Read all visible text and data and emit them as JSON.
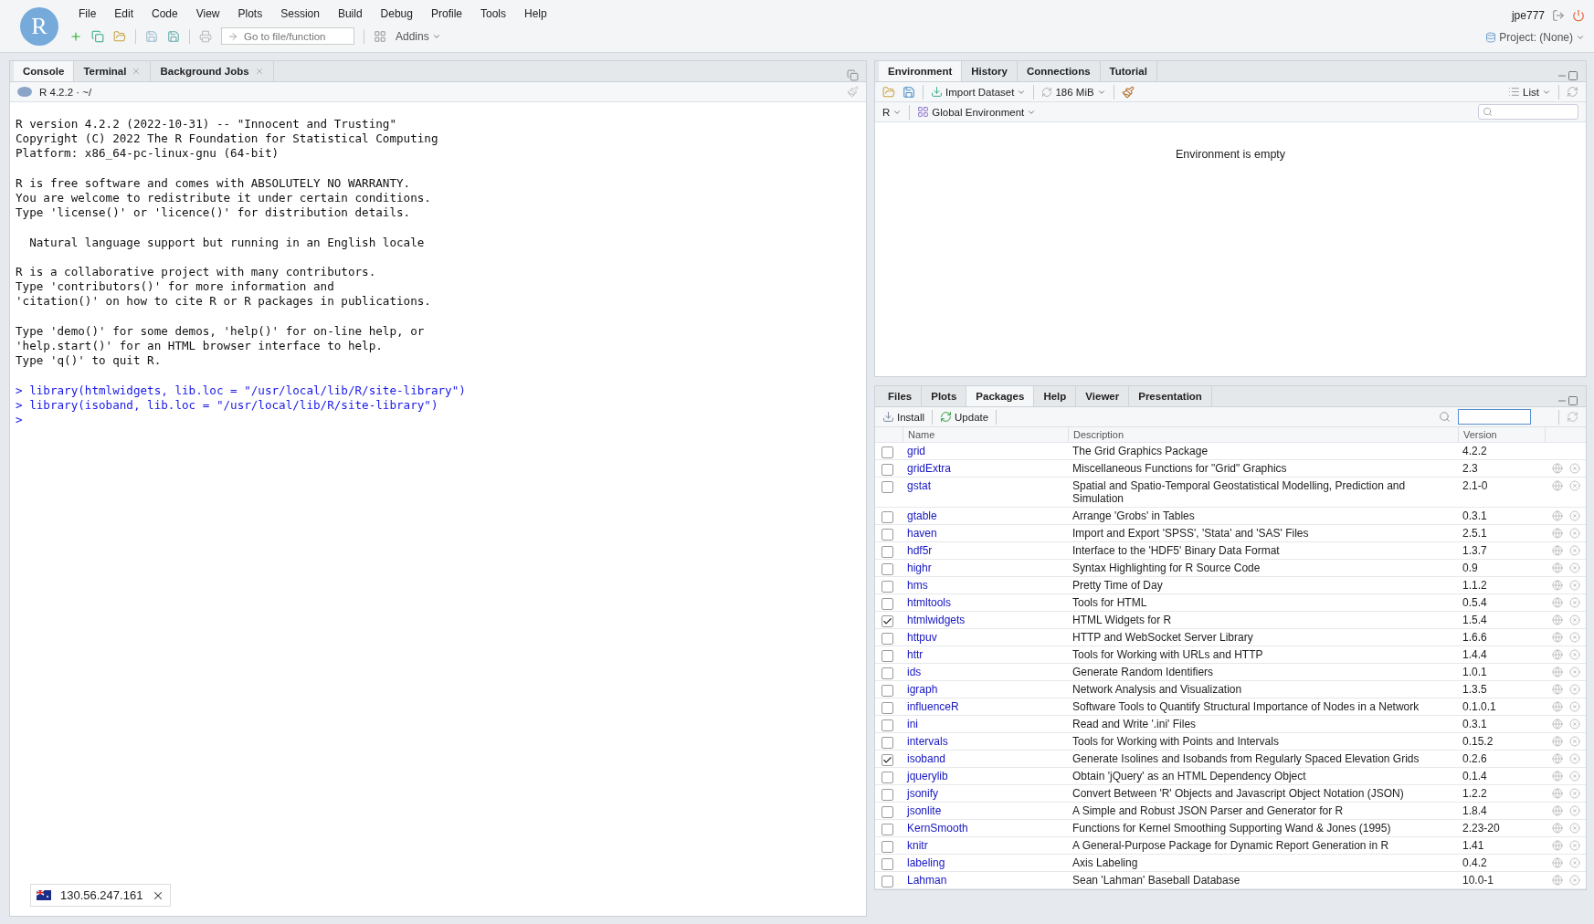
{
  "menu_bar": {
    "logo": "R",
    "items": [
      "File",
      "Edit",
      "Code",
      "View",
      "Plots",
      "Session",
      "Build",
      "Debug",
      "Profile",
      "Tools",
      "Help"
    ],
    "user": "jpe777"
  },
  "toolbar": {
    "goto_placeholder": "Go to file/function",
    "addins": "Addins",
    "project": "Project: (None)"
  },
  "console_pane": {
    "tabs": [
      {
        "label": "Console",
        "selected": true,
        "closable": false
      },
      {
        "label": "Terminal",
        "selected": false,
        "closable": true
      },
      {
        "label": "Background Jobs",
        "selected": false,
        "closable": true
      }
    ],
    "version": "R 4.2.2 · ~/",
    "output": [
      {
        "kind": "text",
        "lines": [
          "R version 4.2.2 (2022-10-31) -- \"Innocent and Trusting\"",
          "Copyright (C) 2022 The R Foundation for Statistical Computing",
          "Platform: x86_64-pc-linux-gnu (64-bit)"
        ]
      },
      {
        "kind": "text",
        "lines": [
          "R is free software and comes with ABSOLUTELY NO WARRANTY.",
          "You are welcome to redistribute it under certain conditions.",
          "Type 'license()' or 'licence()' for distribution details."
        ]
      },
      {
        "kind": "text",
        "lines": [
          "  Natural language support but running in an English locale"
        ]
      },
      {
        "kind": "text",
        "lines": [
          "R is a collaborative project with many contributors.",
          "Type 'contributors()' for more information and",
          "'citation()' on how to cite R or R packages in publications."
        ]
      },
      {
        "kind": "text",
        "lines": [
          "Type 'demo()' for some demos, 'help()' for on-line help, or",
          "'help.start()' for an HTML browser interface to help.",
          "Type 'q()' to quit R."
        ]
      },
      {
        "kind": "command",
        "lines": [
          "> library(htmlwidgets, lib.loc = \"/usr/local/lib/R/site-library\")",
          "> library(isoband, lib.loc = \"/usr/local/lib/R/site-library\")",
          ">"
        ]
      }
    ]
  },
  "environment_pane": {
    "tabs": [
      {
        "label": "Environment",
        "selected": true
      },
      {
        "label": "History",
        "selected": false
      },
      {
        "label": "Connections",
        "selected": false
      },
      {
        "label": "Tutorial",
        "selected": false
      }
    ],
    "import_dataset": "Import Dataset",
    "memory": "186 MiB",
    "view": "List",
    "language": "R",
    "scope": "Global Environment",
    "empty_message": "Environment is empty"
  },
  "packages_pane": {
    "tabs": [
      {
        "label": "Files",
        "selected": false
      },
      {
        "label": "Plots",
        "selected": false
      },
      {
        "label": "Packages",
        "selected": true
      },
      {
        "label": "Help",
        "selected": false
      },
      {
        "label": "Viewer",
        "selected": false
      },
      {
        "label": "Presentation",
        "selected": false
      }
    ],
    "install": "Install",
    "update": "Update",
    "columns": [
      "Name",
      "Description",
      "Version"
    ],
    "rows": [
      {
        "name": "grid",
        "description": "The Grid Graphics Package",
        "version": "4.2.2",
        "checked": false,
        "removable": false
      },
      {
        "name": "gridExtra",
        "description": "Miscellaneous Functions for \"Grid\" Graphics",
        "version": "2.3",
        "checked": false,
        "removable": true
      },
      {
        "name": "gstat",
        "description": "Spatial and Spatio-Temporal Geostatistical Modelling, Prediction and Simulation",
        "version": "2.1-0",
        "checked": false,
        "removable": true
      },
      {
        "name": "gtable",
        "description": "Arrange 'Grobs' in Tables",
        "version": "0.3.1",
        "checked": false,
        "removable": true
      },
      {
        "name": "haven",
        "description": "Import and Export 'SPSS', 'Stata' and 'SAS' Files",
        "version": "2.5.1",
        "checked": false,
        "removable": true
      },
      {
        "name": "hdf5r",
        "description": "Interface to the 'HDF5' Binary Data Format",
        "version": "1.3.7",
        "checked": false,
        "removable": true
      },
      {
        "name": "highr",
        "description": "Syntax Highlighting for R Source Code",
        "version": "0.9",
        "checked": false,
        "removable": true
      },
      {
        "name": "hms",
        "description": "Pretty Time of Day",
        "version": "1.1.2",
        "checked": false,
        "removable": true
      },
      {
        "name": "htmltools",
        "description": "Tools for HTML",
        "version": "0.5.4",
        "checked": false,
        "removable": true
      },
      {
        "name": "htmlwidgets",
        "description": "HTML Widgets for R",
        "version": "1.5.4",
        "checked": true,
        "removable": true
      },
      {
        "name": "httpuv",
        "description": "HTTP and WebSocket Server Library",
        "version": "1.6.6",
        "checked": false,
        "removable": true
      },
      {
        "name": "httr",
        "description": "Tools for Working with URLs and HTTP",
        "version": "1.4.4",
        "checked": false,
        "removable": true
      },
      {
        "name": "ids",
        "description": "Generate Random Identifiers",
        "version": "1.0.1",
        "checked": false,
        "removable": true
      },
      {
        "name": "igraph",
        "description": "Network Analysis and Visualization",
        "version": "1.3.5",
        "checked": false,
        "removable": true
      },
      {
        "name": "influenceR",
        "description": "Software Tools to Quantify Structural Importance of Nodes in a Network",
        "version": "0.1.0.1",
        "checked": false,
        "removable": true
      },
      {
        "name": "ini",
        "description": "Read and Write '.ini' Files",
        "version": "0.3.1",
        "checked": false,
        "removable": true
      },
      {
        "name": "intervals",
        "description": "Tools for Working with Points and Intervals",
        "version": "0.15.2",
        "checked": false,
        "removable": true
      },
      {
        "name": "isoband",
        "description": "Generate Isolines and Isobands from Regularly Spaced Elevation Grids",
        "version": "0.2.6",
        "checked": true,
        "removable": true
      },
      {
        "name": "jquerylib",
        "description": "Obtain 'jQuery' as an HTML Dependency Object",
        "version": "0.1.4",
        "checked": false,
        "removable": true
      },
      {
        "name": "jsonify",
        "description": "Convert Between 'R' Objects and Javascript Object Notation (JSON)",
        "version": "1.2.2",
        "checked": false,
        "removable": true
      },
      {
        "name": "jsonlite",
        "description": "A Simple and Robust JSON Parser and Generator for R",
        "version": "1.8.4",
        "checked": false,
        "removable": true
      },
      {
        "name": "KernSmooth",
        "description": "Functions for Kernel Smoothing Supporting Wand & Jones (1995)",
        "version": "2.23-20",
        "checked": false,
        "removable": true
      },
      {
        "name": "knitr",
        "description": "A General-Purpose Package for Dynamic Report Generation in R",
        "version": "1.41",
        "checked": false,
        "removable": true
      },
      {
        "name": "labeling",
        "description": "Axis Labeling",
        "version": "0.4.2",
        "checked": false,
        "removable": true
      },
      {
        "name": "Lahman",
        "description": "Sean 'Lahman' Baseball Database",
        "version": "10.0-1",
        "checked": false,
        "removable": true
      }
    ]
  },
  "ip_popup": {
    "address": "130.56.247.161"
  }
}
